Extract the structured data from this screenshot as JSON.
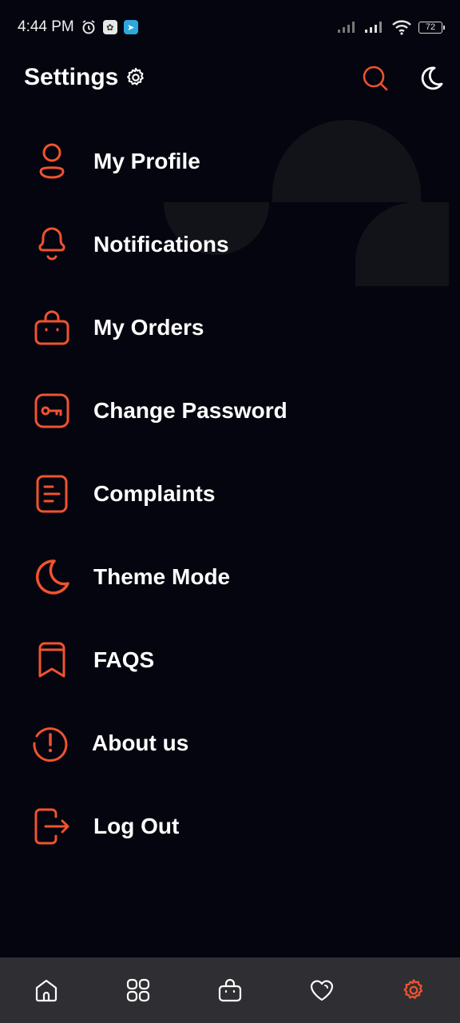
{
  "status_bar": {
    "time": "4:44 PM",
    "battery": "72"
  },
  "header": {
    "title": "Settings",
    "icons": [
      "gear-icon",
      "search-icon",
      "moon-icon"
    ]
  },
  "menu": [
    {
      "label": "My Profile",
      "icon": "profile-icon"
    },
    {
      "label": "Notifications",
      "icon": "bell-icon"
    },
    {
      "label": "My Orders",
      "icon": "bag-icon"
    },
    {
      "label": "Change Password",
      "icon": "key-icon"
    },
    {
      "label": "Complaints",
      "icon": "document-icon"
    },
    {
      "label": "Theme Mode",
      "icon": "moon-icon"
    },
    {
      "label": "FAQS",
      "icon": "bookmark-icon"
    },
    {
      "label": "About us",
      "icon": "info-icon"
    },
    {
      "label": "Log Out",
      "icon": "logout-icon"
    }
  ],
  "bottom_nav": [
    {
      "icon": "home-icon",
      "active": false
    },
    {
      "icon": "categories-icon",
      "active": false
    },
    {
      "icon": "bag-icon",
      "active": false
    },
    {
      "icon": "heart-icon",
      "active": false
    },
    {
      "icon": "gear-icon",
      "active": true
    }
  ],
  "colors": {
    "accent": "#f0532e",
    "background": "#05050f",
    "nav_background": "#2f2f33",
    "text": "#ffffff"
  }
}
